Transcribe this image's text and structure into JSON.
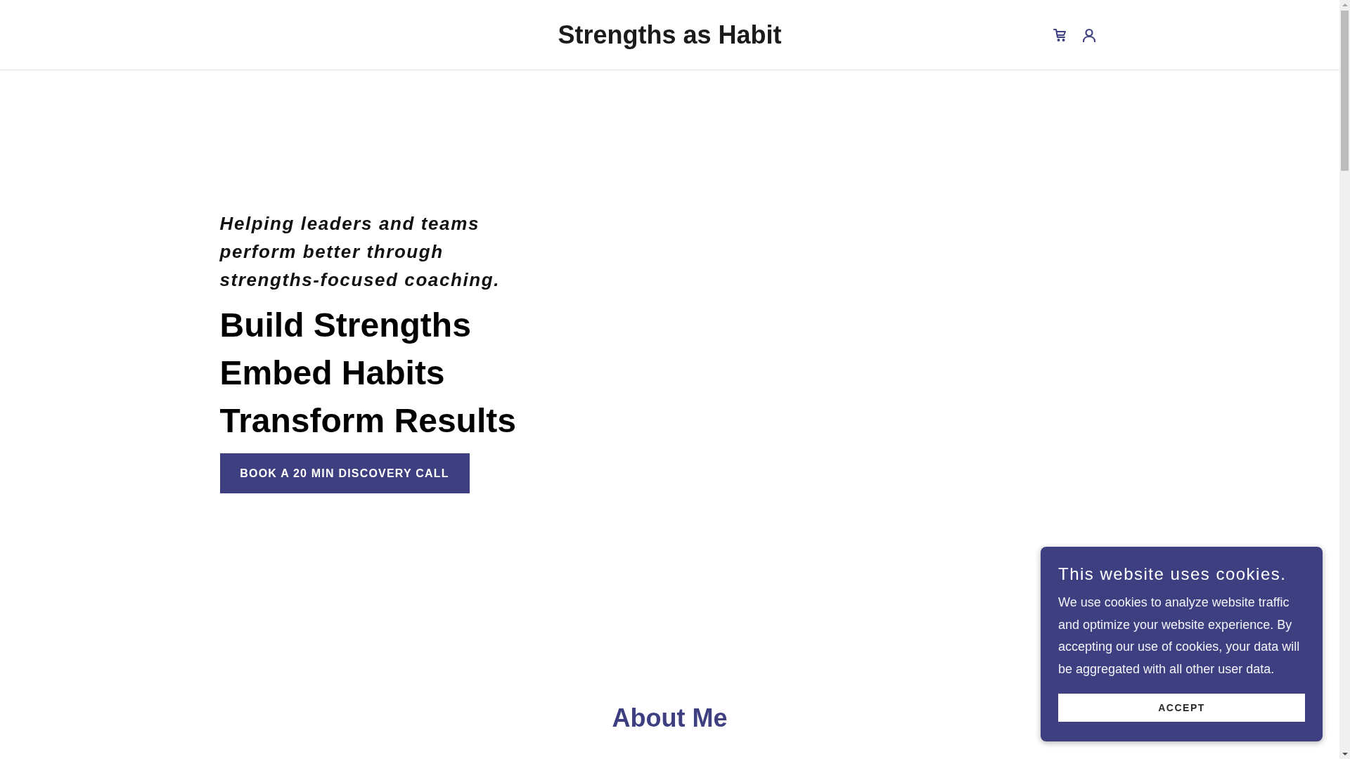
{
  "header": {
    "title": "Strengths as Habit"
  },
  "hero": {
    "tagline": "Helping leaders and teams perform better through strengths-focused coaching.",
    "headlines": [
      "Build Strengths",
      "Embed Habits",
      "Transform Results"
    ],
    "cta": "BOOK A 20 MIN DISCOVERY CALL"
  },
  "about": {
    "heading": "About Me"
  },
  "cookie_banner": {
    "title": "This website uses cookies.",
    "message": "We use cookies to analyze website traffic and optimize your website experience. By accepting our use of cookies, your data will be aggregated with all other user data.",
    "button": "ACCEPT"
  }
}
